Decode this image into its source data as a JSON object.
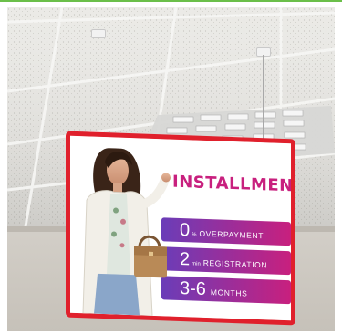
{
  "sign": {
    "title": "INSTALLMENT",
    "rows": [
      {
        "value": "0",
        "unit": "%",
        "label": "OVERPAYMENT"
      },
      {
        "value": "2",
        "unit": "min",
        "label": "REGISTRATION"
      },
      {
        "value": "3-6",
        "unit": "",
        "label": "MONTHS"
      }
    ]
  },
  "colors": {
    "frame_red": "#e0202c",
    "title_magenta": "#c8207e",
    "band_start": "#6a3db8",
    "band_end": "#c8207e",
    "top_border": "#6bbf4a"
  }
}
